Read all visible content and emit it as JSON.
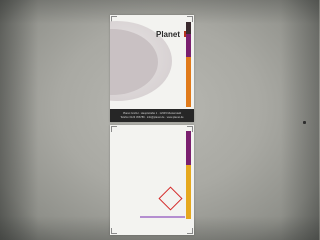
{
  "document": {
    "pages": [
      {
        "id": "top",
        "logo_text": "Planet",
        "footer_lines": [
          "Planet GmbH · Hauptstraße 1 · 12345 Musterstadt",
          "Telefon 0123 456789 · info@planet.de · www.planet.de"
        ]
      },
      {
        "id": "bottom"
      }
    ]
  },
  "colors": {
    "background": "#a9a9a3",
    "page": "#f3f3f0",
    "accent_purple": "#7a1f6e",
    "accent_orange": "#e07a1a",
    "accent_yellow": "#e6a81e",
    "accent_red": "#d52b2b",
    "accent_lilac": "#b48ed0",
    "logo_mark": "#b5331e"
  }
}
